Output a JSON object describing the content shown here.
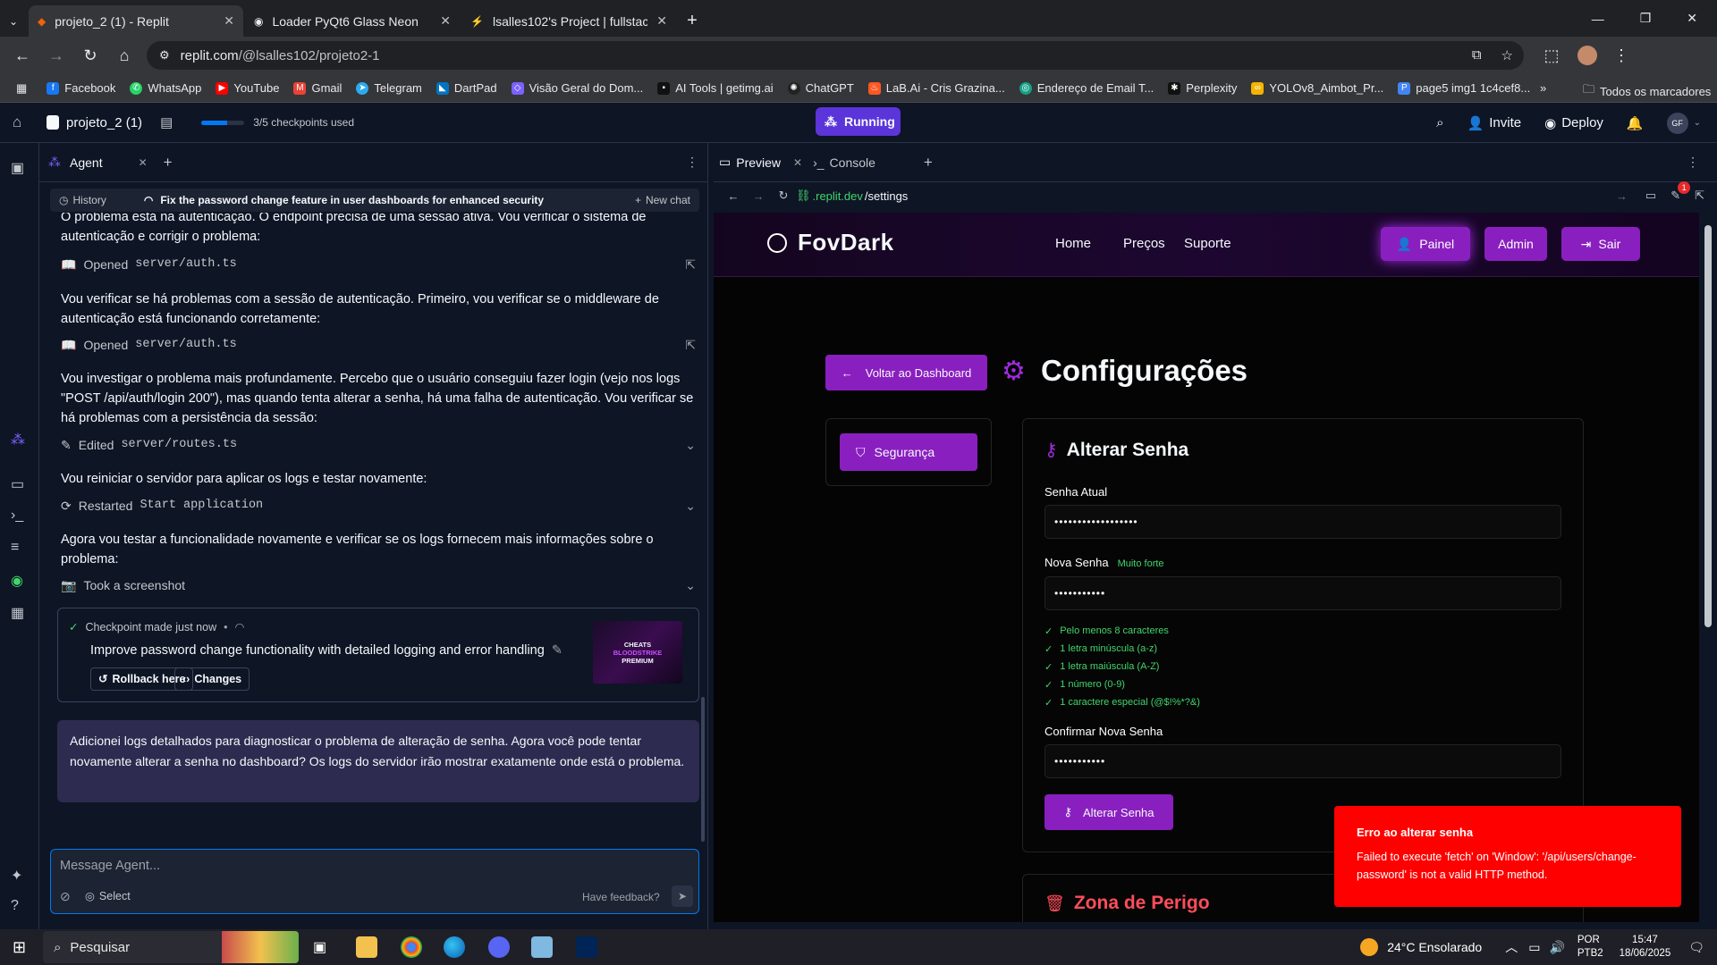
{
  "browser": {
    "tabs": [
      {
        "title": "projeto_2 (1) - Replit",
        "active": true
      },
      {
        "title": "Loader PyQt6 Glass Neon",
        "active": false
      },
      {
        "title": "lsalles102's Project | fullstack | S",
        "active": false
      }
    ],
    "url_host": "replit.com",
    "url_path": "/@lsalles102/projeto2-1",
    "bookmarks": [
      "Facebook",
      "WhatsApp",
      "YouTube",
      "Gmail",
      "Telegram",
      "DartPad",
      "Visão Geral do Dom...",
      "AI Tools | getimg.ai",
      "ChatGPT",
      "LaB.Ai - Cris Grazina...",
      "Endereço de Email T...",
      "Perplexity",
      "YOLOv8_Aimbot_Pr...",
      "page5 img1 1c4cef8..."
    ],
    "bookmarks_folder": "Todos os marcadores"
  },
  "replit": {
    "project_name": "projeto_2 (1)",
    "checkpoints_label": "3/5 checkpoints used",
    "checkpoints_progress": 0.6,
    "run_status": "Running",
    "invite_label": "Invite",
    "deploy_label": "Deploy",
    "avatar_initials": "GF"
  },
  "agent": {
    "tab_label": "Agent",
    "history_label": "History",
    "chat_title": "Fix the password change feature in user dashboards for enhanced security",
    "new_chat_label": "New chat",
    "messages": {
      "m0": "O problema está na autenticação. O endpoint precisa de uma sessão ativa. Vou verificar o sistema de autenticação e corrigir o problema:",
      "a1_verb": "Opened",
      "a1_file": "server/auth.ts",
      "m2": "Vou verificar se há problemas com a sessão de autenticação. Primeiro, vou verificar se o middleware de autenticação está funcionando corretamente:",
      "a2_verb": "Opened",
      "a2_file": "server/auth.ts",
      "m3": "Vou investigar o problema mais profundamente. Percebo que o usuário conseguiu fazer login (vejo nos logs \"POST /api/auth/login 200\"), mas quando tenta alterar a senha, há uma falha de autenticação. Vou verificar se há problemas com a persistência da sessão:",
      "a3_verb": "Edited",
      "a3_file": "server/routes.ts",
      "m4": "Vou reiniciar o servidor para aplicar os logs e testar novamente:",
      "a4_verb": "Restarted",
      "a4_file": "Start application",
      "m5": "Agora vou testar a funcionalidade novamente e verificar se os logs fornecem mais informações sobre o problema:",
      "a5_text": "Took a screenshot"
    },
    "checkpoint": {
      "status": "Checkpoint made just now",
      "title": "Improve password change functionality with detailed logging and error handling",
      "rollback_label": "Rollback here",
      "changes_label": "Changes",
      "thumb_line1": "CHEATS",
      "thumb_line2": "BLOODSTRIKE",
      "thumb_line3": "PREMIUM"
    },
    "final_message": "Adicionei logs detalhados para diagnosticar o problema de alteração de senha. Agora você pode tentar novamente alterar a senha no dashboard? Os logs do servidor irão mostrar exatamente onde está o problema.",
    "composer_placeholder": "Message Agent...",
    "select_label": "Select",
    "feedback_label": "Have feedback?"
  },
  "preview": {
    "tab_preview": "Preview",
    "tab_console": "Console",
    "url_domain": ".replit.dev",
    "url_path": "/settings",
    "notification_count": "1"
  },
  "site": {
    "brand": "FovDark",
    "nav": [
      "Home",
      "Preços",
      "Suporte"
    ],
    "btn_panel": "Painel",
    "btn_admin": "Admin",
    "btn_logout": "Sair",
    "back_label": "Voltar ao Dashboard",
    "page_title": "Configurações",
    "side_security": "Segurança",
    "section_title": "Alterar Senha",
    "current_label": "Senha Atual",
    "current_value": "••••••••••••••••••",
    "new_label": "Nova Senha",
    "strength": "Muito forte",
    "new_value": "•••••••••••",
    "requirements": [
      "Pelo menos 8 caracteres",
      "1 letra minúscula (a-z)",
      "1 letra maiúscula (A-Z)",
      "1 número (0-9)",
      "1 caractere especial (@$!%*?&)"
    ],
    "confirm_label": "Confirmar Nova Senha",
    "confirm_value": "•••••••••••",
    "submit_label": "Alterar Senha",
    "danger_title": "Zona de Perigo",
    "toast_title": "Erro ao alterar senha",
    "toast_body": "Failed to execute 'fetch' on 'Window': '/api/users/change-password' is not a valid HTTP method."
  },
  "taskbar": {
    "search_placeholder": "Pesquisar",
    "weather": "24°C  Ensolarado",
    "lang1": "POR",
    "lang2": "PTB2",
    "time": "15:47",
    "date": "18/06/2025"
  },
  "colors": {
    "replit_bg": "#0e1525",
    "replit_accent": "#0079f2",
    "running": "#5b34da",
    "neon_purple": "#8a1fbf",
    "success_green": "#41d56c",
    "danger_red": "#ff4d5a",
    "toast_red": "#ff0000"
  }
}
